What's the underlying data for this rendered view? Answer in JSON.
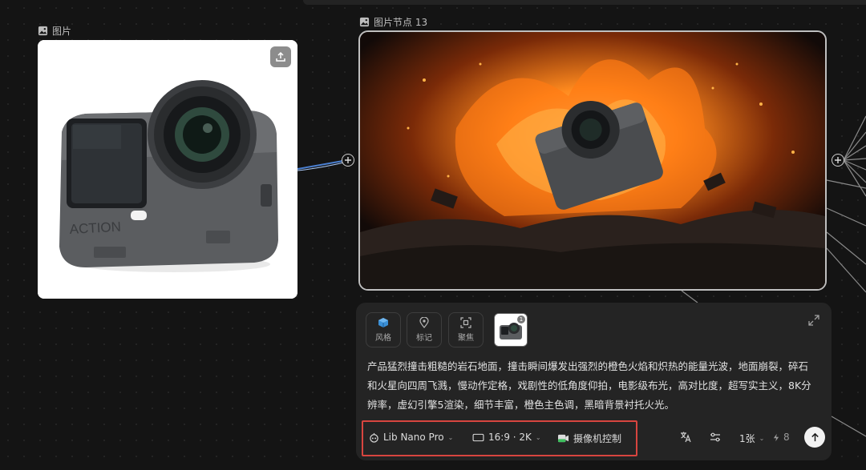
{
  "canvas": {
    "left_node": {
      "label": "图片",
      "icon": "image-icon",
      "upload_icon": "upload-icon"
    },
    "right_node": {
      "label": "图片节点 13",
      "icon": "image-icon"
    }
  },
  "panel": {
    "tools": [
      {
        "label": "风格",
        "icon": "cube-icon"
      },
      {
        "label": "标记",
        "icon": "pin-icon"
      },
      {
        "label": "聚焦",
        "icon": "focus-icon"
      }
    ],
    "reference_count": "1",
    "prompt": "产品猛烈撞击粗糙的岩石地面，撞击瞬间爆发出强烈的橙色火焰和炽热的能量光波，地面崩裂，碎石和火星向四周飞溅，慢动作定格，戏剧性的低角度仰拍，电影级布光，高对比度，超写实主义，8K分辨率，虚幻引擎5渲染，细节丰富，橙色主色调，黑暗背景衬托火光。",
    "model": "Lib Nano Pro",
    "ratio": "16:9 · 2K",
    "camera_control": "摄像机控制",
    "count": "1张",
    "credits": "8"
  },
  "colors": {
    "highlight": "#d8453f",
    "accent_green": "#3fbf5f"
  }
}
